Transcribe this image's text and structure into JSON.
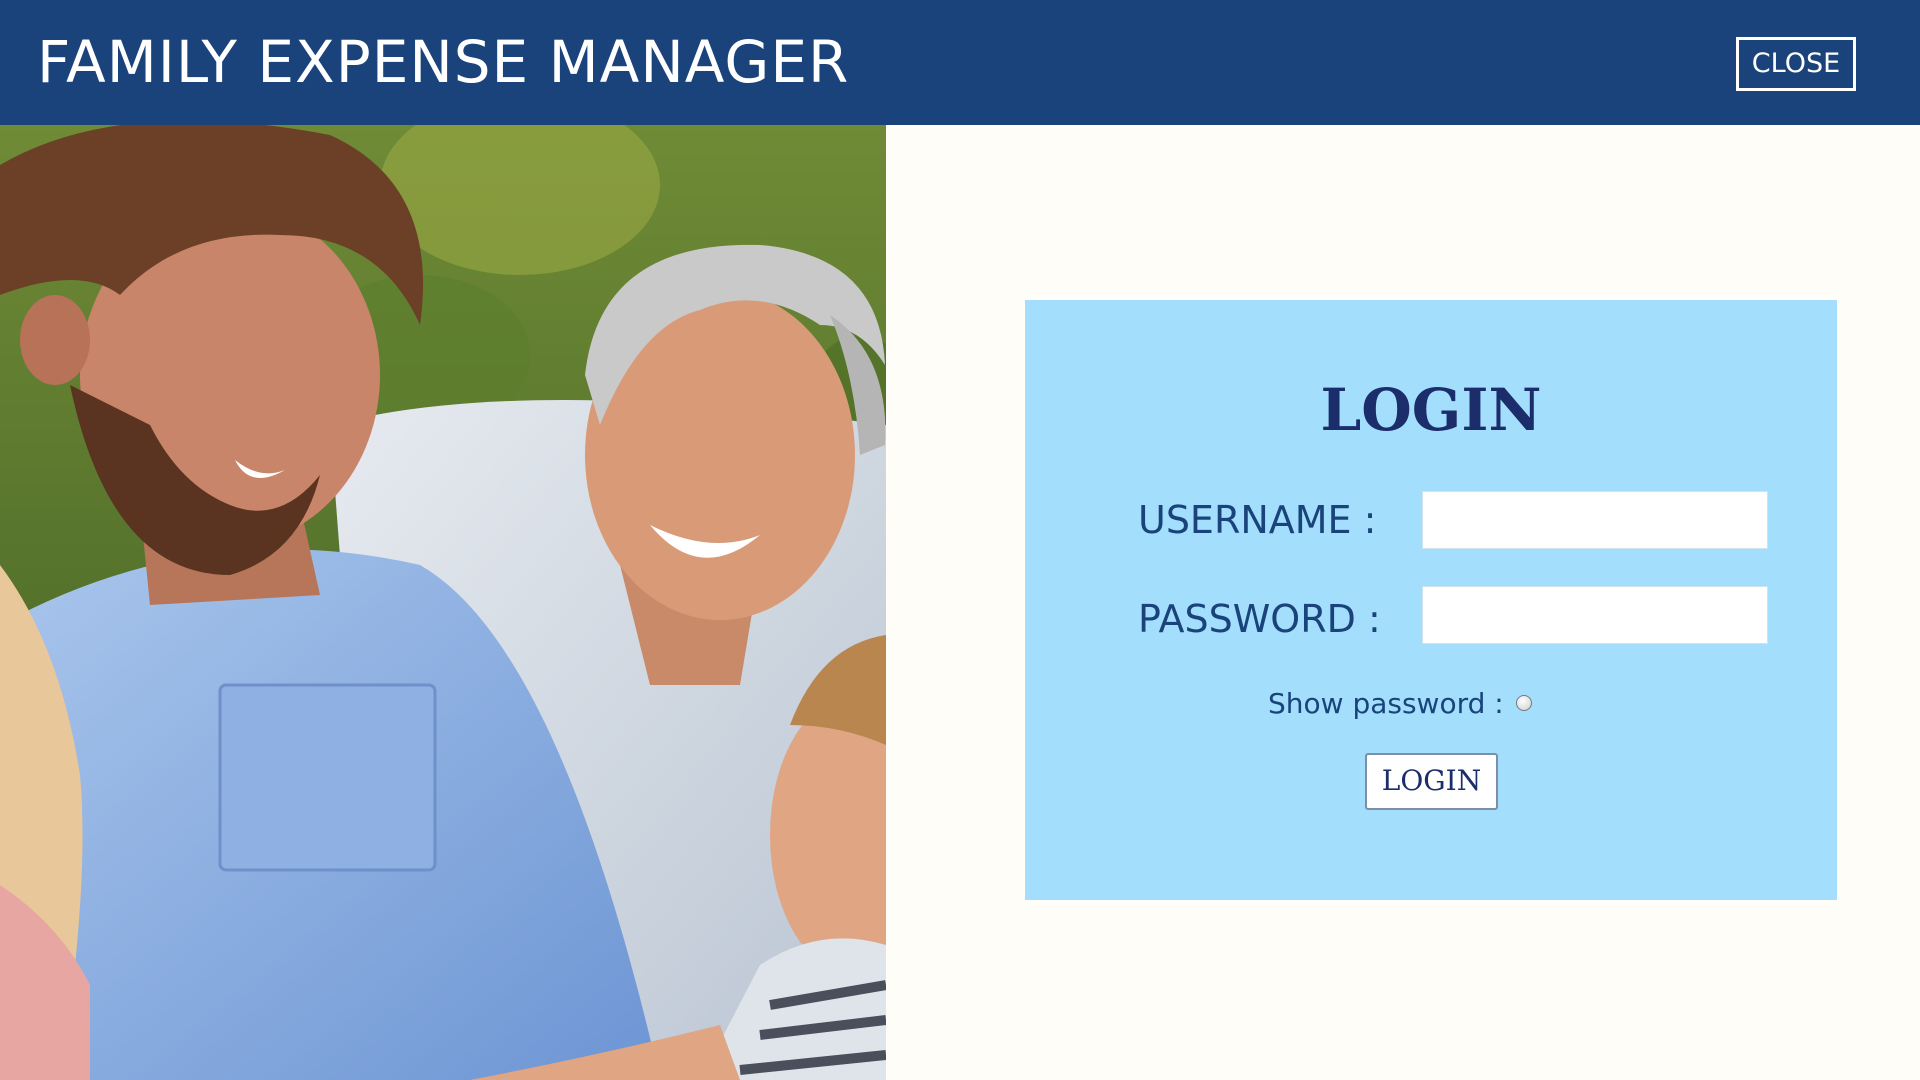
{
  "header": {
    "title": "FAMILY EXPENSE MANAGER",
    "close_label": "CLOSE"
  },
  "photo": {
    "description_icon": "family-photo"
  },
  "login": {
    "title": "LOGIN",
    "username_label": "USERNAME :",
    "username_value": "",
    "password_label": "PASSWORD :",
    "password_value": "",
    "show_password_label": "Show password :",
    "show_password_checked": false,
    "button_label": "LOGIN"
  },
  "colors": {
    "header_bg": "#1a437c",
    "page_bg": "#fefdf8",
    "card_bg": "#a3dffc",
    "title_text": "#1b2d6b",
    "label_text": "#1a437c"
  }
}
